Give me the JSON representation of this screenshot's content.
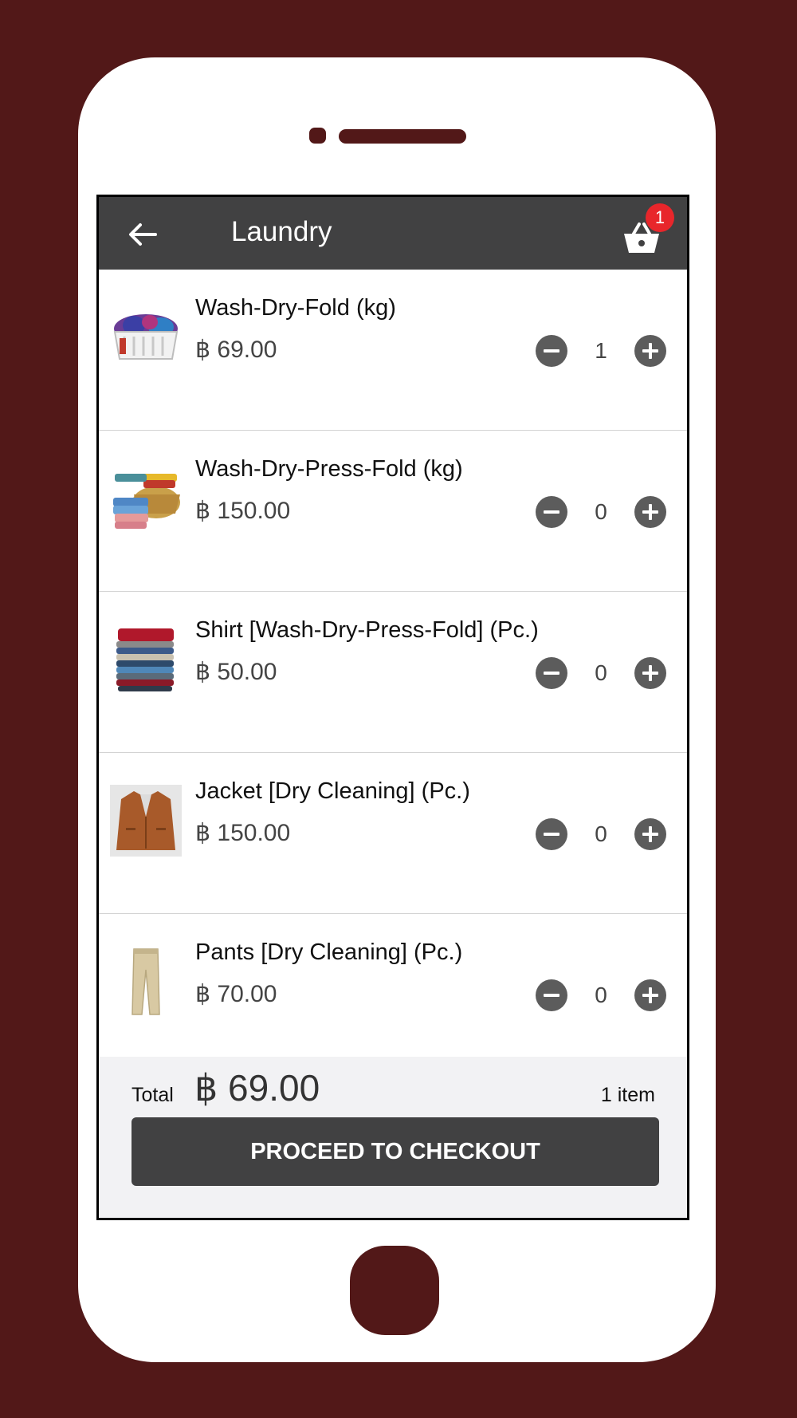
{
  "header": {
    "back_icon": "arrow-left-icon",
    "title": "Laundry",
    "cart_icon": "basket-icon",
    "cart_badge": "1"
  },
  "items": [
    {
      "name": "Wash-Dry-Fold (kg)",
      "price": "฿ 69.00",
      "qty": "1",
      "image": "laundry-basket-image"
    },
    {
      "name": "Wash-Dry-Press-Fold (kg)",
      "price": "฿ 150.00",
      "qty": "0",
      "image": "folded-towels-basket-image"
    },
    {
      "name": "Shirt [Wash-Dry-Press-Fold] (Pc.)",
      "price": "฿ 50.00",
      "qty": "0",
      "image": "folded-shirts-image"
    },
    {
      "name": "Jacket [Dry Cleaning] (Pc.)",
      "price": "฿ 150.00",
      "qty": "0",
      "image": "jacket-image"
    },
    {
      "name": "Pants [Dry Cleaning] (Pc.)",
      "price": "฿ 70.00",
      "qty": "0",
      "image": "pants-image"
    }
  ],
  "footer": {
    "total_label": "Total",
    "total_value": "฿ 69.00",
    "item_count": "1 item",
    "checkout_label": "PROCEED TO CHECKOUT"
  },
  "colors": {
    "background": "#521818",
    "appbar": "#414142",
    "badge": "#e8262b",
    "qty_button": "#5c5c5c",
    "footer_bg": "#f2f2f4"
  }
}
